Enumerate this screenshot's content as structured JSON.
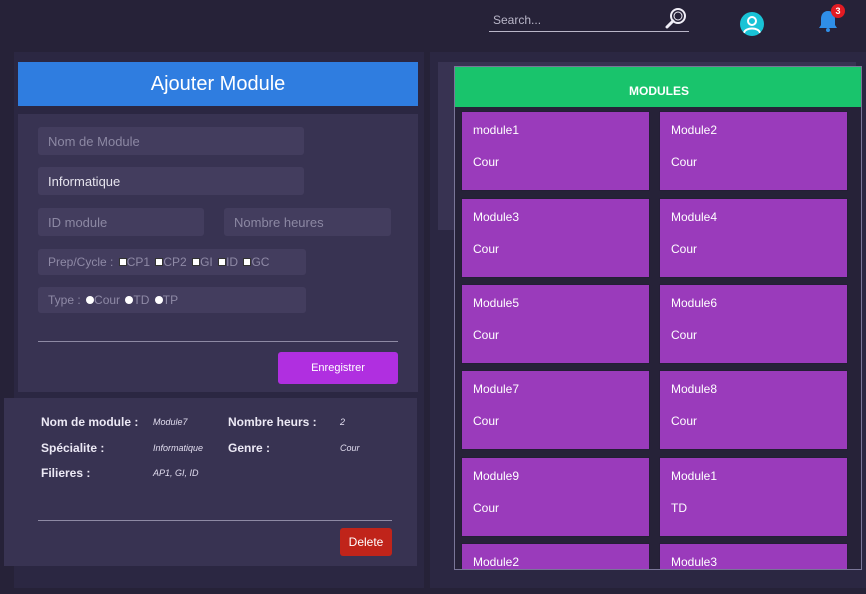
{
  "search": {
    "placeholder": "Search..."
  },
  "notifications": {
    "count": "3"
  },
  "form": {
    "title": "Ajouter Module",
    "module_name_placeholder": "Nom de Module",
    "speciality_value": "Informatique",
    "id_placeholder": "ID module",
    "hours_placeholder": "Nombre heures",
    "cycle_label": "Prep/Cycle :",
    "cycle_options": [
      "CP1",
      "CP2",
      "GI",
      "ID",
      "GC"
    ],
    "type_label": "Type :",
    "type_options": [
      "Cour",
      "TD",
      "TP"
    ],
    "save_label": "Enregistrer"
  },
  "details": {
    "name_label": "Nom de module :",
    "name_value": "Module7",
    "hours_label": "Nombre heurs :",
    "hours_value": "2",
    "speciality_label": "Spécialite :",
    "speciality_value": "Informatique",
    "genre_label": "Genre :",
    "genre_value": "Cour",
    "filieres_label": "Filieres :",
    "filieres_value": "AP1, GI, ID",
    "delete_label": "Delete"
  },
  "modules": {
    "title": "MODULES",
    "items": [
      {
        "name": "module1",
        "type": "Cour"
      },
      {
        "name": "Module2",
        "type": "Cour"
      },
      {
        "name": "Module3",
        "type": "Cour"
      },
      {
        "name": "Module4",
        "type": "Cour"
      },
      {
        "name": "Module5",
        "type": "Cour"
      },
      {
        "name": "Module6",
        "type": "Cour"
      },
      {
        "name": "Module7",
        "type": "Cour"
      },
      {
        "name": "Module8",
        "type": "Cour"
      },
      {
        "name": "Module9",
        "type": "Cour"
      },
      {
        "name": "Module1",
        "type": "TD"
      },
      {
        "name": "Module2",
        "type": ""
      },
      {
        "name": "Module3",
        "type": ""
      }
    ]
  }
}
